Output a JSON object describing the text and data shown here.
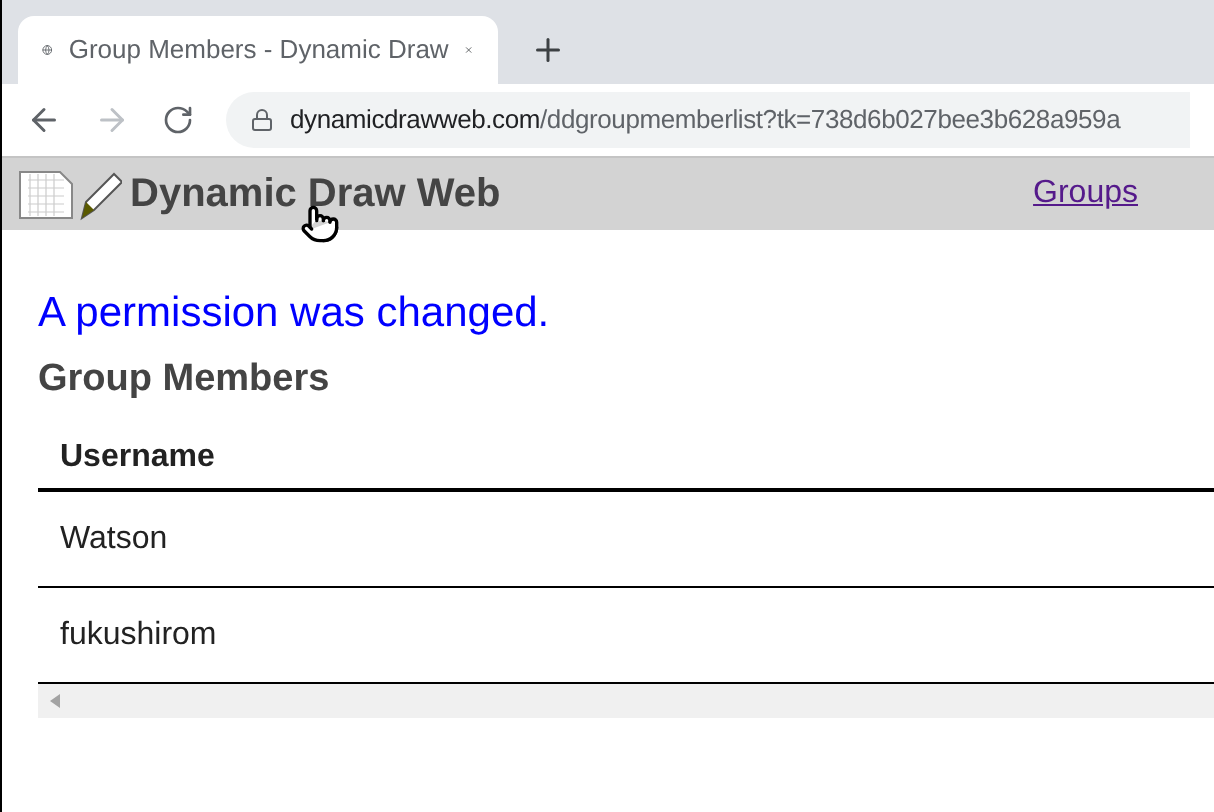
{
  "browser": {
    "tab": {
      "title": "Group Members - Dynamic Draw",
      "selected": true
    },
    "address": {
      "domain": "dynamicdrawweb.com",
      "path": "/ddgroupmemberlist?tk=738d6b027bee3b628a959a"
    }
  },
  "header": {
    "brand": "Dynamic Draw Web",
    "nav_link": "Groups"
  },
  "message": "A permission was changed.",
  "heading": "Group Members",
  "table": {
    "columns": [
      "Username"
    ],
    "rows": [
      [
        "Watson"
      ],
      [
        "fukushirom"
      ]
    ]
  }
}
